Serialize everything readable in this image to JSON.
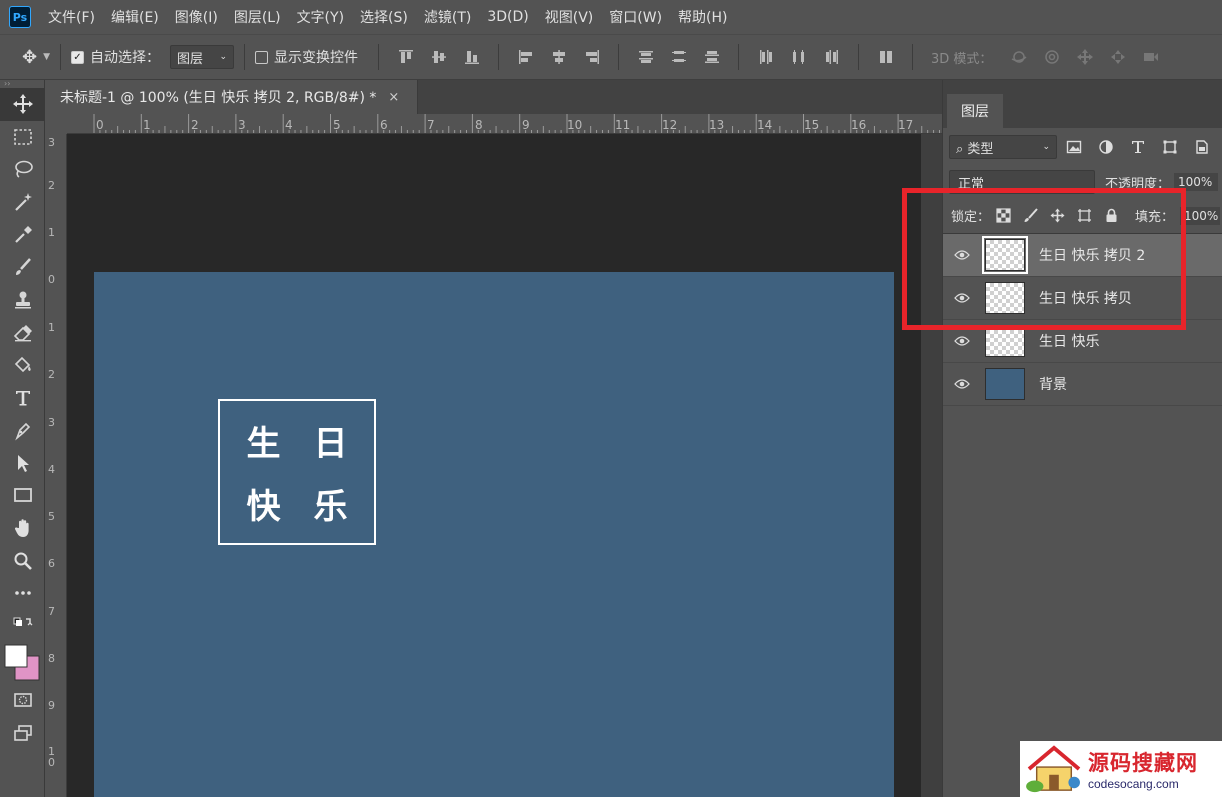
{
  "app": {
    "logo": "Ps"
  },
  "menu": [
    "文件(F)",
    "编辑(E)",
    "图像(I)",
    "图层(L)",
    "文字(Y)",
    "选择(S)",
    "滤镜(T)",
    "3D(D)",
    "视图(V)",
    "窗口(W)",
    "帮助(H)"
  ],
  "options": {
    "auto_select_label": "自动选择：",
    "auto_select_checked": true,
    "auto_select_target": "图层",
    "show_transform_label": "显示变换控件",
    "show_transform_checked": false,
    "mode_3d_label": "3D 模式："
  },
  "document": {
    "tab_title": "未标题-1 @ 100% (生日 快乐 拷贝 2, RGB/8#) *",
    "close_glyph": "×",
    "canvas_color": "#3f617f"
  },
  "ruler": {
    "top_labels": [
      "0",
      "1",
      "2",
      "3",
      "4",
      "5",
      "6",
      "7",
      "8",
      "9",
      "10",
      "11",
      "12",
      "13",
      "14",
      "15",
      "16",
      "17"
    ],
    "left_labels": [
      "3",
      "2",
      "1",
      "0",
      "1",
      "2",
      "3",
      "4",
      "5",
      "6",
      "7",
      "8",
      "9",
      "1 0"
    ]
  },
  "stamp": {
    "chars": [
      "生",
      "日",
      "快",
      "乐"
    ]
  },
  "layers_panel": {
    "tab_label": "图层",
    "filter_label": "类型",
    "blend_mode": "正常",
    "opacity_label": "不透明度：",
    "opacity_value": "100%",
    "lock_label": "锁定：",
    "fill_label": "填充：",
    "fill_value": "100%",
    "layers": [
      {
        "name": "生日 快乐 拷贝 2",
        "selected": true,
        "visible": true,
        "thumb": "transparent"
      },
      {
        "name": "生日 快乐 拷贝",
        "selected": false,
        "visible": true,
        "thumb": "transparent"
      },
      {
        "name": "生日 快乐",
        "selected": false,
        "visible": true,
        "thumb": "transparent"
      },
      {
        "name": "背景",
        "selected": false,
        "visible": true,
        "thumb": "solid"
      }
    ]
  },
  "highlight_color": "#e8242a",
  "watermark": {
    "title": "源码搜藏网",
    "url": "codesocang.com"
  }
}
